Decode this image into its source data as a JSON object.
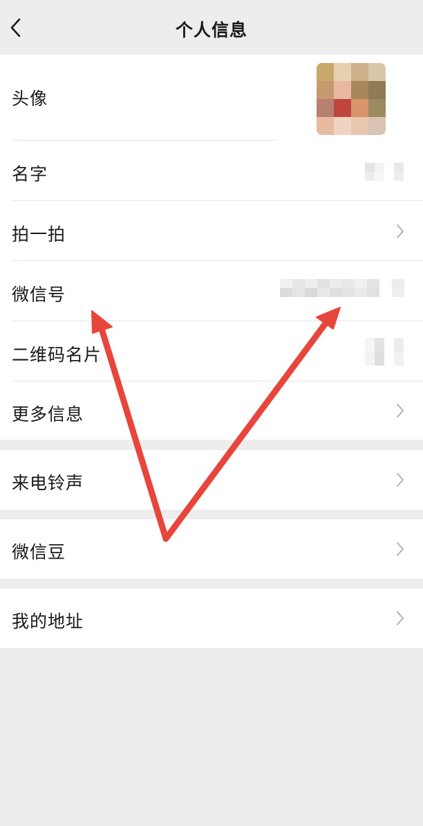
{
  "navbar": {
    "title": "个人信息",
    "back_icon": "chevron-left-icon"
  },
  "groups": [
    {
      "items": [
        {
          "key": "avatar",
          "label": "头像",
          "chevron": false
        },
        {
          "key": "name",
          "label": "名字",
          "chevron": false
        },
        {
          "key": "pat",
          "label": "拍一拍",
          "chevron": true
        },
        {
          "key": "wechat-id",
          "label": "微信号",
          "chevron": false
        },
        {
          "key": "qr-card",
          "label": "二维码名片",
          "chevron": false
        },
        {
          "key": "more-info",
          "label": "更多信息",
          "chevron": true
        }
      ]
    },
    {
      "items": [
        {
          "key": "ringtone",
          "label": "来电铃声",
          "chevron": true
        }
      ]
    },
    {
      "items": [
        {
          "key": "wechat-beans",
          "label": "微信豆",
          "chevron": true
        }
      ]
    },
    {
      "items": [
        {
          "key": "my-address",
          "label": "我的地址",
          "chevron": true
        }
      ]
    }
  ],
  "colors": {
    "background": "#ededed",
    "cell": "#ffffff",
    "text": "#191919",
    "chevron": "#b2b2b2",
    "annotation_arrow": "#e8463c"
  },
  "annotation": {
    "type": "check-mark arrows",
    "icon": "red-arrow-icon"
  }
}
